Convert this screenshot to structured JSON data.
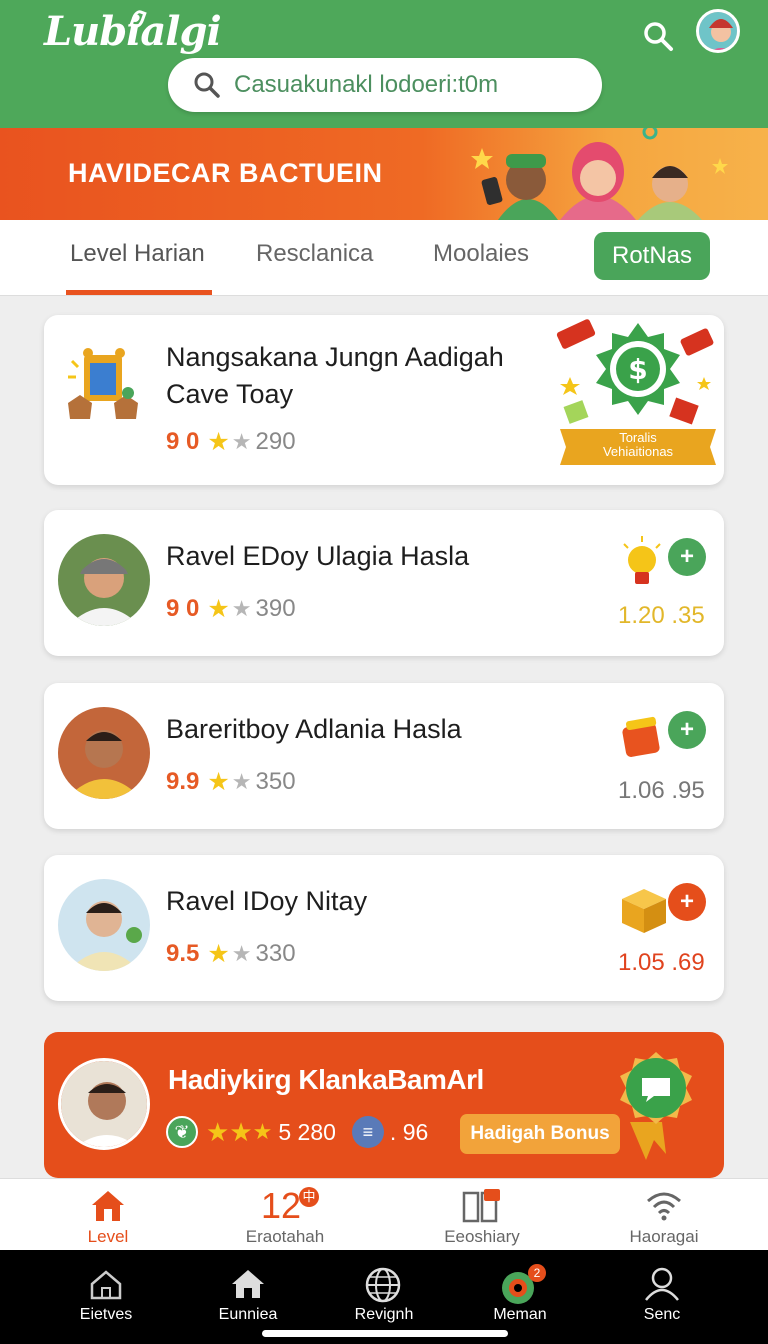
{
  "header": {
    "logo": "Lubialgi",
    "search_placeholder": "Casuakunakl lodoeri:t0m",
    "icons": [
      "search-icon",
      "user-avatar"
    ]
  },
  "banner": {
    "title": "HAVIDECAR BACTUEIN"
  },
  "tabs": [
    {
      "label": "Level Harian",
      "active": true
    },
    {
      "label": "Resclanica"
    },
    {
      "label": "Moolaies"
    },
    {
      "label": "RotNas",
      "pill": true
    }
  ],
  "cards": [
    {
      "title_line1": "Nangsakana Jungn Aadigah",
      "title_line2": "Cave Toay",
      "score": "9 0",
      "count": "290",
      "badge_line1": "Toralis",
      "badge_line2": "Vehiaitionas"
    },
    {
      "title": "Ravel EDoy Ulagia Hasla",
      "score": "9 0",
      "count": "390",
      "value": "1.20 .35"
    },
    {
      "title": "Bareritboy Adlania Hasla",
      "score": "9.9",
      "count": "350",
      "value": "1.06 .95"
    },
    {
      "title": "Ravel IDoy Nitay",
      "score": "9.5",
      "count": "330",
      "value": "1.05 .69"
    }
  ],
  "promo": {
    "title": "Hadiykirg KlankaBamArl",
    "rating": "5 280",
    "value": ". 96",
    "bonus_label": "Hadigah Bonus"
  },
  "bottom_nav": [
    {
      "label": "Level",
      "active": true
    },
    {
      "label": "Eraotahah",
      "number": "12"
    },
    {
      "label": "Eeoshiary"
    },
    {
      "label": "Haoragai"
    }
  ],
  "system_nav": [
    {
      "label": "Eietves"
    },
    {
      "label": "Eunniea"
    },
    {
      "label": "Revignh"
    },
    {
      "label": "Meman",
      "badge": "2"
    },
    {
      "label": "Senc"
    }
  ],
  "colors": {
    "green": "#4ea85a",
    "orange": "#e9531f",
    "gold": "#f5c518"
  }
}
